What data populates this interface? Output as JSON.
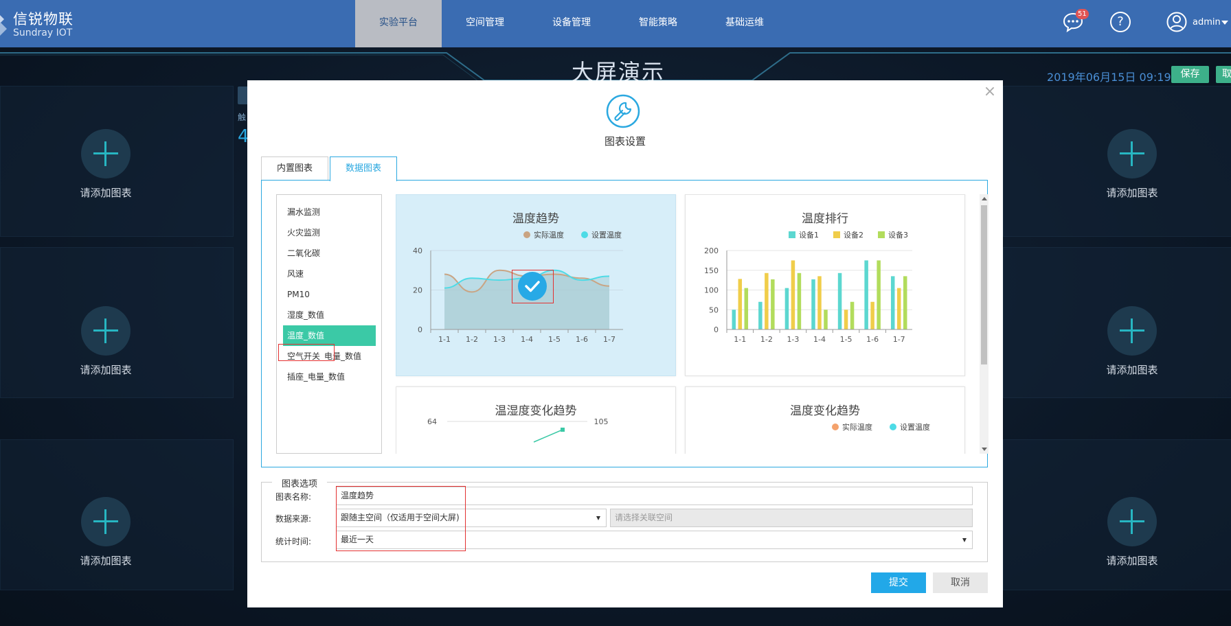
{
  "brand": {
    "name_cn": "信锐物联",
    "name_en": "Sundray IOT"
  },
  "nav": [
    "实验平台",
    "空间管理",
    "设备管理",
    "智能策略",
    "基础运维"
  ],
  "nav_active": 0,
  "header": {
    "message_count": "51",
    "help": "?",
    "user": "admin"
  },
  "dashboard": {
    "title": "大屏演示",
    "datetime": "2019年06月15日  09:19",
    "save_label": "保存",
    "cancel_label": "取",
    "add_chart_label": "请添加图表",
    "left_fragment_top": "触",
    "left_fragment_num": "4"
  },
  "modal": {
    "title": "图表设置",
    "close": "×",
    "tabs": [
      "内置图表",
      "数据图表"
    ],
    "active_tab": 1,
    "list": [
      "漏水监测",
      "火灾监测",
      "二氧化碳",
      "风速",
      "PM10",
      "湿度_数值",
      "温度_数值",
      "空气开关_电量_数值",
      "插座_电量_数值"
    ],
    "selected_index": 6,
    "options": {
      "legend": "图表选项",
      "name_label": "图表名称:",
      "name_value": "温度趋势",
      "source_label": "数据来源:",
      "source_value": "跟随主空间（仅适用于空间大屏)",
      "space_placeholder": "请选择关联空间",
      "time_label": "统计时间:",
      "time_value": "最近一天"
    },
    "submit": "提交",
    "cancel": "取消"
  },
  "colors": {
    "accent": "#2aa8e0",
    "selected": "#3bc9a6",
    "nav": "#3a6cb2",
    "highlight": "#e33030"
  },
  "chart_data": [
    {
      "type": "area",
      "title": "温度趋势",
      "categories": [
        "1-1",
        "1-2",
        "1-3",
        "1-4",
        "1-5",
        "1-6",
        "1-7"
      ],
      "ylim": [
        0,
        40
      ],
      "yticks": [
        "0",
        "20",
        "40"
      ],
      "legend_position": "top-right",
      "series": [
        {
          "name": "实际温度",
          "color": "#c9a483",
          "values": [
            28,
            19,
            30,
            27,
            28,
            26,
            22
          ]
        },
        {
          "name": "设置温度",
          "color": "#4ddbe6",
          "values": [
            21,
            26,
            25,
            26,
            30,
            25,
            27
          ]
        }
      ]
    },
    {
      "type": "bar",
      "title": "温度排行",
      "categories": [
        "1-1",
        "1-2",
        "1-3",
        "1-4",
        "1-5",
        "1-6",
        "1-7"
      ],
      "ylim": [
        0,
        200
      ],
      "yticks": [
        "0",
        "50",
        "100",
        "150",
        "200"
      ],
      "legend_position": "top-right",
      "series": [
        {
          "name": "设备1",
          "color": "#5cd7d0",
          "values": [
            50,
            70,
            105,
            127,
            143,
            175,
            135
          ]
        },
        {
          "name": "设备2",
          "color": "#f0cd4a",
          "values": [
            128,
            143,
            175,
            135,
            50,
            70,
            105
          ]
        },
        {
          "name": "设备3",
          "color": "#b2dc5c",
          "values": [
            105,
            127,
            143,
            50,
            70,
            175,
            135
          ]
        }
      ]
    },
    {
      "type": "line",
      "title": "温湿度变化趋势",
      "y_left_top": "64",
      "y_right_top": "105"
    },
    {
      "type": "line",
      "title": "温度变化趋势",
      "legend_position": "top-right",
      "series": [
        {
          "name": "实际温度",
          "color": "#f4a26c"
        },
        {
          "name": "设置温度",
          "color": "#4ddbe6"
        }
      ]
    }
  ]
}
